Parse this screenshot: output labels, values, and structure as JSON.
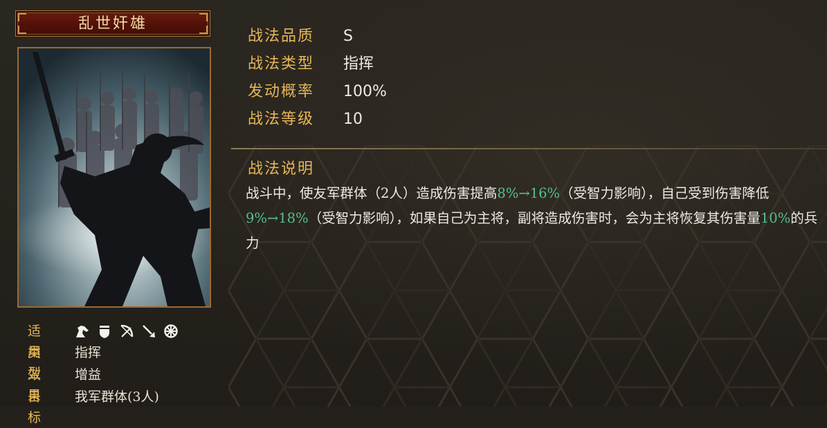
{
  "skill": {
    "name": "乱世奸雄"
  },
  "card_info": {
    "suitable_label": "适用",
    "suitable_icons": [
      "cavalry-icon",
      "shield-icon",
      "bow-icon",
      "spear-icon",
      "siege-wheel-icon"
    ],
    "type_label": "类型",
    "type_value": "指挥",
    "effect_label": "效果",
    "effect_value": "增益",
    "target_label": "目标",
    "target_value": "我军群体(3人)"
  },
  "stats": {
    "quality_label": "战法品质",
    "quality_value": "S",
    "category_label": "战法类型",
    "category_value": "指挥",
    "rate_label": "发动概率",
    "rate_value": "100%",
    "level_label": "战法等级",
    "level_value": "10"
  },
  "description": {
    "title": "战法说明",
    "segments": [
      {
        "text": "战斗中，使友军群体（2人）造成伤害提高",
        "hl": false
      },
      {
        "text": "8%→16%",
        "hl": true
      },
      {
        "text": "（受智力影响），自己受到伤害降低",
        "hl": false
      },
      {
        "text": "9%→18%",
        "hl": true
      },
      {
        "text": "（受智力影响），如果自己为主将，副将造成伤害时，会为主将恢复其伤害量",
        "hl": false
      },
      {
        "text": "10%",
        "hl": true
      },
      {
        "text": "的兵力",
        "hl": false
      }
    ]
  },
  "colors": {
    "gold_label": "#e5b658",
    "text": "#ecebe6",
    "highlight_green": "#55c08c",
    "title_plate": "#521108"
  }
}
